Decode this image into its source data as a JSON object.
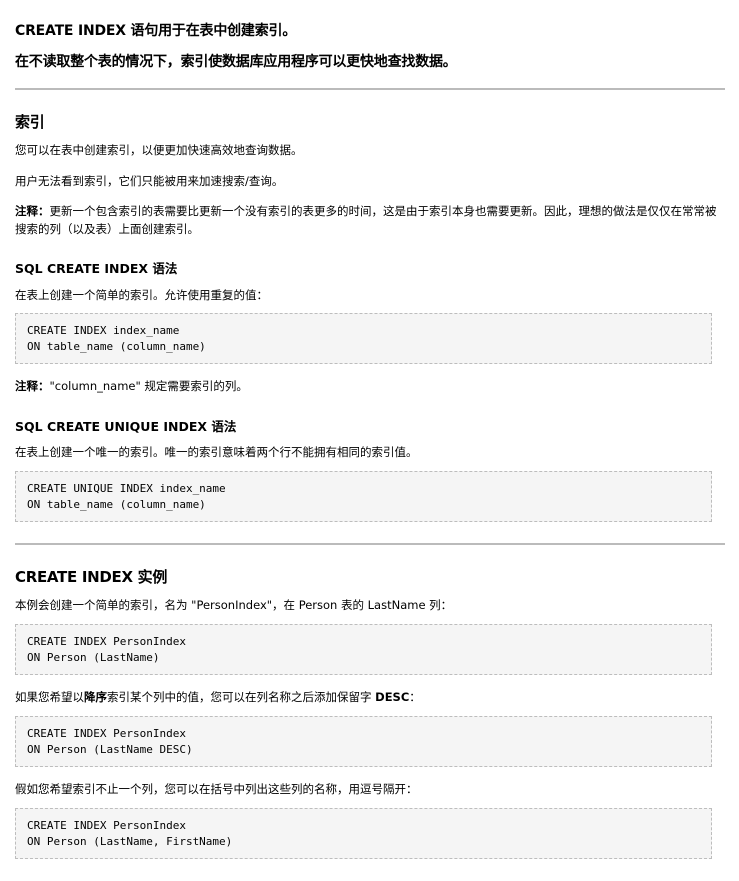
{
  "intro": {
    "line1": "CREATE INDEX 语句用于在表中创建索引。",
    "line2": "在不读取整个表的情况下，索引使数据库应用程序可以更快地查找数据。"
  },
  "index_section": {
    "title": "索引",
    "p1": "您可以在表中创建索引，以便更加快速高效地查询数据。",
    "p2": "用户无法看到索引，它们只能被用来加速搜索/查询。",
    "note_label": "注释：",
    "note_text": "更新一个包含索引的表需要比更新一个没有索引的表更多的时间，这是由于索引本身也需要更新。因此，理想的做法是仅仅在常常被搜索的列（以及表）上面创建索引。"
  },
  "syntax_section": {
    "title": "SQL CREATE INDEX 语法",
    "desc": "在表上创建一个简单的索引。允许使用重复的值：",
    "code": [
      "CREATE INDEX index_name",
      "ON table_name (column_name)"
    ],
    "note_label": "注释：",
    "note_text": "\"column_name\" 规定需要索引的列。"
  },
  "unique_section": {
    "title": "SQL CREATE UNIQUE INDEX 语法",
    "desc": "在表上创建一个唯一的索引。唯一的索引意味着两个行不能拥有相同的索引值。",
    "code": [
      "CREATE UNIQUE INDEX index_name",
      "ON table_name (column_name)"
    ]
  },
  "example_section": {
    "title": "CREATE INDEX 实例",
    "desc1": "本例会创建一个简单的索引，名为 \"PersonIndex\"，在 Person 表的 LastName 列：",
    "code1": [
      "CREATE INDEX PersonIndex",
      "ON Person (LastName)"
    ],
    "desc2_a": "如果您希望以",
    "desc2_b": "降序",
    "desc2_c": "索引某个列中的值，您可以在列名称之后添加保留字 ",
    "desc2_d": "DESC",
    "desc2_e": "：",
    "code2": [
      "CREATE INDEX PersonIndex",
      "ON Person (LastName DESC)"
    ],
    "desc3": "假如您希望索引不止一个列，您可以在括号中列出这些列的名称，用逗号隔开：",
    "code3": [
      "CREATE INDEX PersonIndex",
      "ON Person (LastName, FirstName)"
    ]
  }
}
